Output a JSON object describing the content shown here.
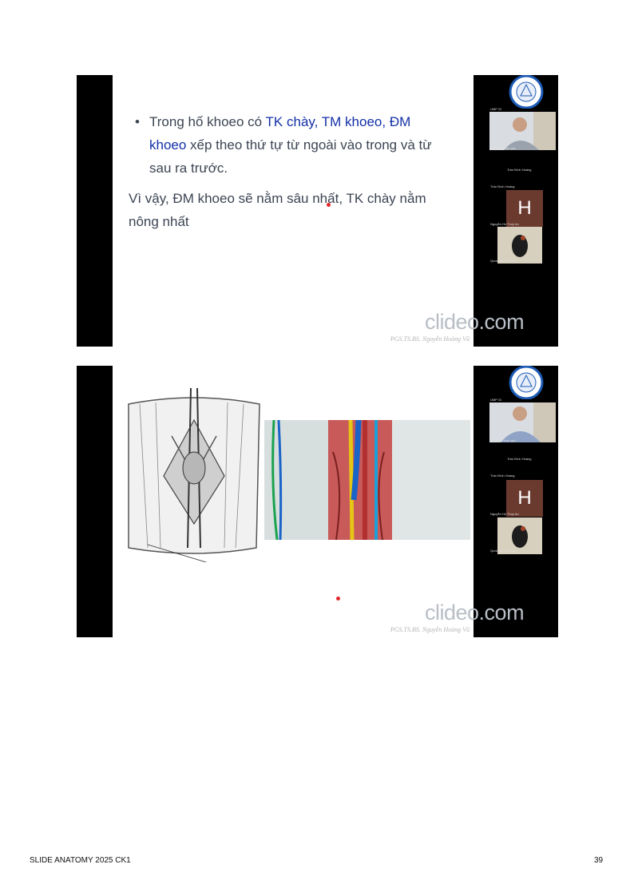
{
  "slide1": {
    "bullet_parts": [
      "Trong hố khoeo có ",
      "TK chày, TM khoeo, ĐM khoeo",
      " xếp theo thứ tự từ ngoài vào trong và từ sau ra trước."
    ],
    "paragraph": "Vì vậy, ĐM khoeo sẽ nằm sâu nhất, TK chày nằm nông nhất",
    "author": "PGS.TS.BS. Nguyễn Hoàng Vũ",
    "watermark": "clideo.com"
  },
  "slide2": {
    "author": "PGS.TS.BS. Nguyễn Hoàng Vũ",
    "watermark": "clideo.com"
  },
  "participants": {
    "video_caption": "Nguyen Hoan gnx",
    "host_label": "Trần Đình Hoàng",
    "host_label_small": "Trần Đình Hoàng",
    "avatar_letter": "H",
    "participant_2": "Nguyễn Hồ Thuỳ An",
    "participant_3": "Quốc Bảo Trương",
    "top_tag": "UMP Gi"
  },
  "footer": {
    "title": "SLIDE ANATOMY 2025 CK1",
    "page_number": "39"
  },
  "colors": {
    "highlight_text": "#1330a8",
    "body_text": "#3c4553",
    "laser_pointer": "#e2262d",
    "avatar_bg": "#6b3a2f"
  }
}
